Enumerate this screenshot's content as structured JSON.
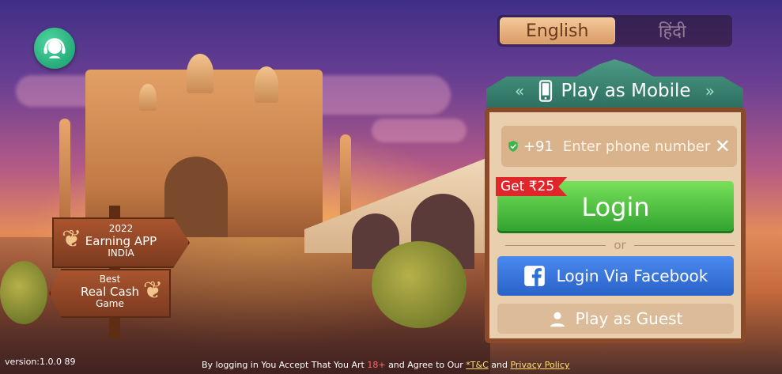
{
  "language": {
    "options": [
      "English",
      "हिंदी"
    ],
    "selected": "English"
  },
  "panel": {
    "title": "Play as Mobile",
    "phone": {
      "country_code": "+91",
      "placeholder": "Enter phone number",
      "value": ""
    },
    "bonus_label": "Get ₹25",
    "login_label": "Login",
    "or_label": "or",
    "facebook_label": "Login Via Facebook",
    "guest_label": "Play as Guest"
  },
  "signs": {
    "sign1": {
      "line1": "2022",
      "line2": "Earning APP",
      "line3": "INDIA"
    },
    "sign2": {
      "line1": "Best",
      "line2": "Real Cash",
      "line3": "Game"
    }
  },
  "footer": {
    "version": "version:1.0.0 89",
    "text_1": "By logging in You Accept That You Art",
    "age": "18+",
    "text_2": "and Agree to Our",
    "tnc_link": "*T&C",
    "text_3": "and",
    "privacy_link": "Privacy Policy"
  },
  "colors": {
    "login_green": "#3bb33b",
    "facebook_blue": "#2f6fd8",
    "panel_bg": "#e9cfae",
    "panel_border": "#8a4a2a",
    "header_teal": "#2d6f60",
    "bonus_red": "#e1262b"
  },
  "icons": {
    "help": "headset-support-icon",
    "mobile": "mobile-phone-icon",
    "shield": "shield-check-icon",
    "clear": "close-x-icon",
    "facebook": "facebook-icon",
    "guest": "person-icon"
  }
}
